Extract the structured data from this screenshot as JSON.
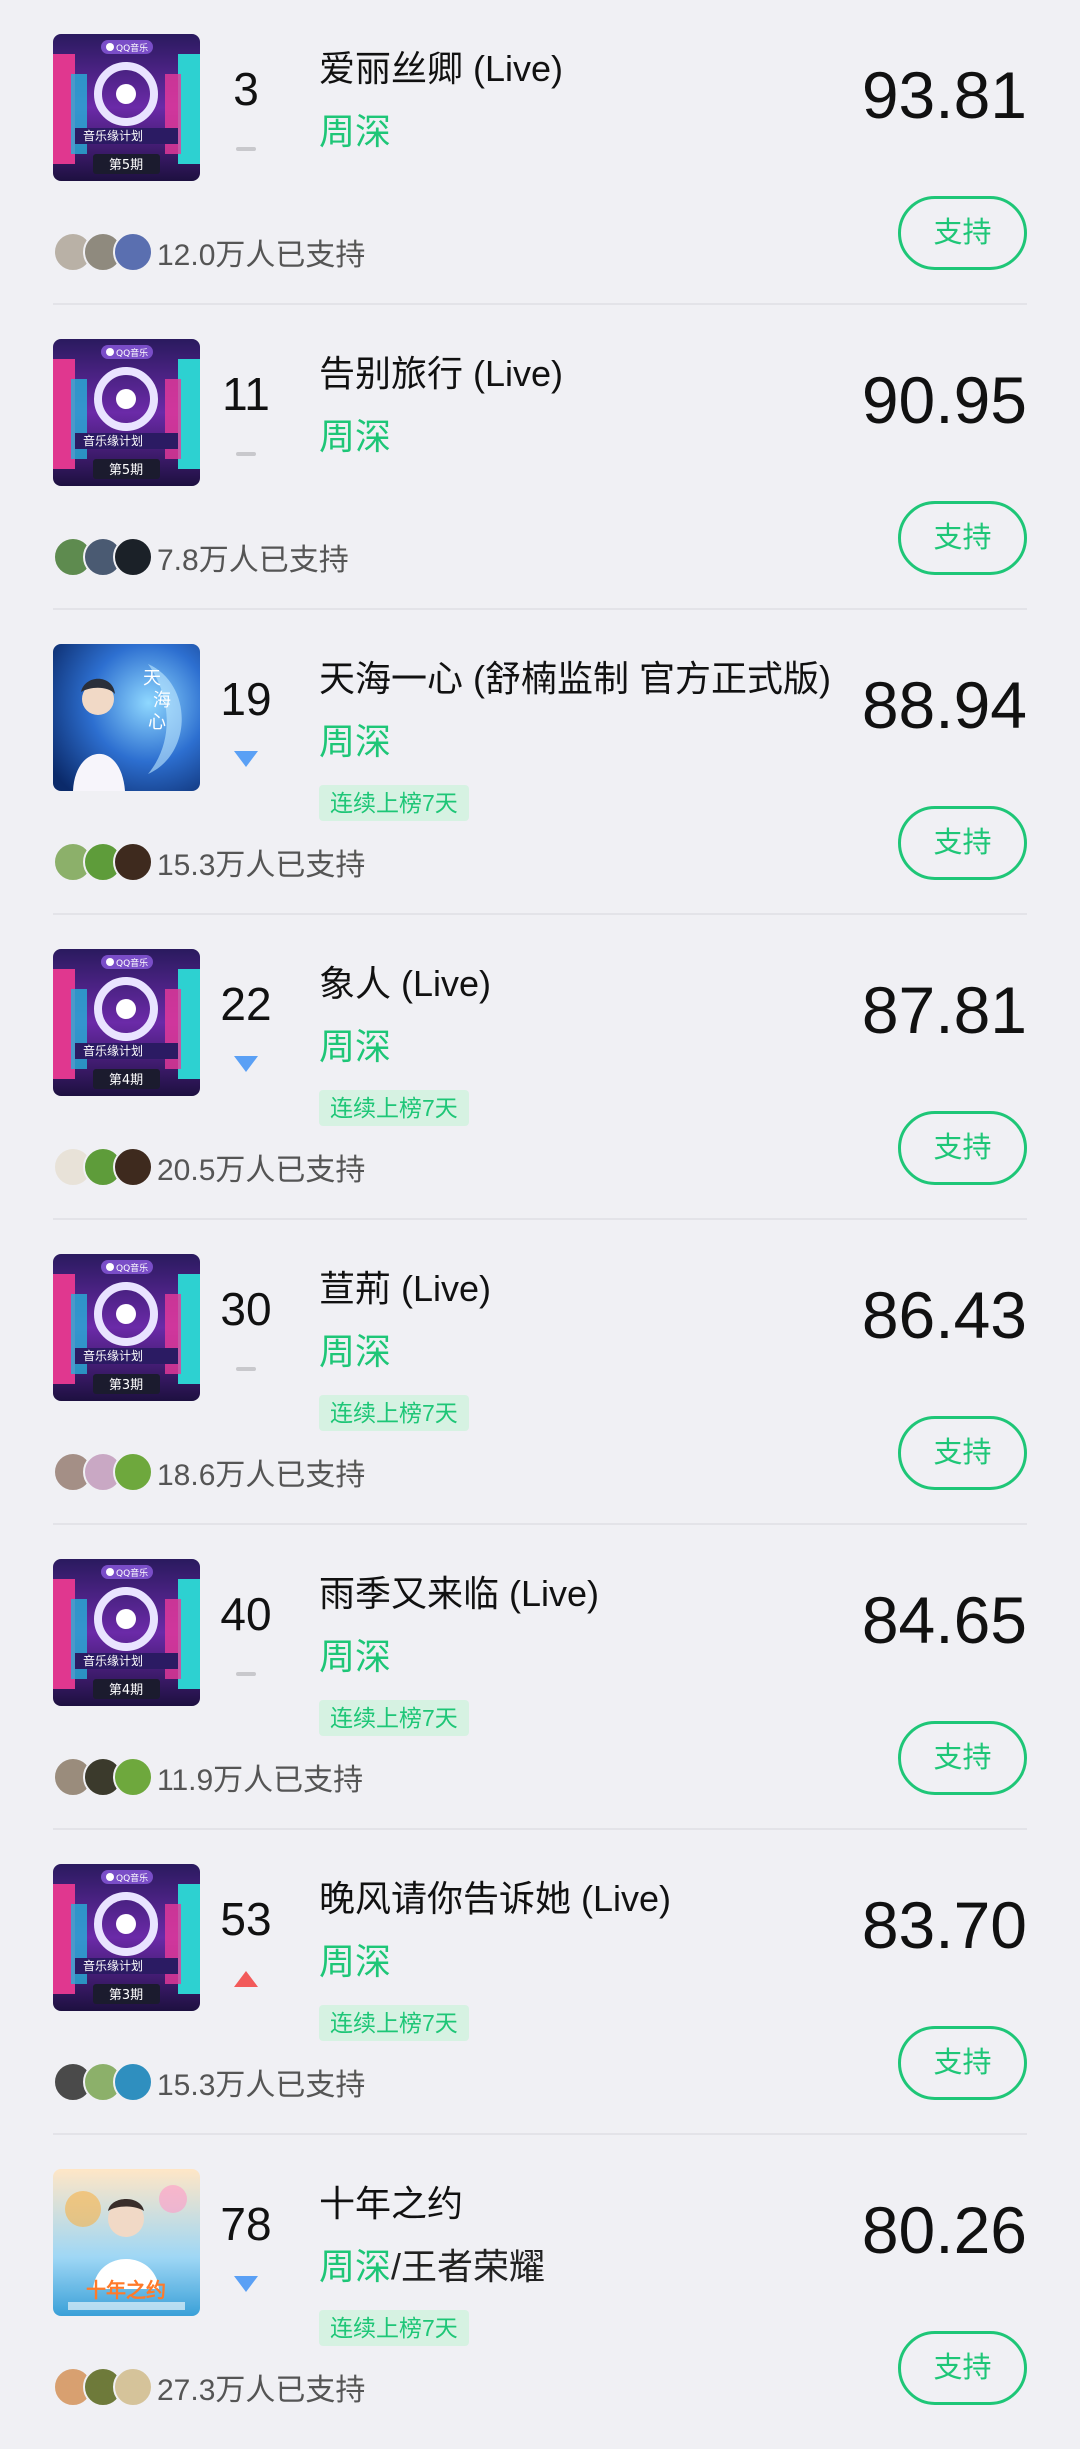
{
  "items": [
    {
      "rank": "3",
      "trend": "flat",
      "title": "爱丽丝卿 (Live)",
      "artists": [
        "周深"
      ],
      "badge": "",
      "score": "93.81",
      "supporters": "12.0万人已支持",
      "button": "支持",
      "cover": "show",
      "cover_episode": "第5期",
      "avatar_colors": [
        "#b9b1a6",
        "#8f8a7e",
        "#5a6fb0"
      ]
    },
    {
      "rank": "11",
      "trend": "flat",
      "title": "告别旅行 (Live)",
      "artists": [
        "周深"
      ],
      "badge": "",
      "score": "90.95",
      "supporters": "7.8万人已支持",
      "button": "支持",
      "cover": "show",
      "cover_episode": "第5期",
      "avatar_colors": [
        "#5e8b4f",
        "#4a5a72",
        "#1b2128"
      ]
    },
    {
      "rank": "19",
      "trend": "down",
      "title": "天海一心 (舒楠监制 官方正式版)",
      "artists": [
        "周深"
      ],
      "badge": "连续上榜7天",
      "score": "88.94",
      "supporters": "15.3万人已支持",
      "button": "支持",
      "cover": "ocean",
      "cover_episode": "",
      "avatar_colors": [
        "#8cb06a",
        "#5e9c3a",
        "#3e2a1e"
      ]
    },
    {
      "rank": "22",
      "trend": "down",
      "title": "象人 (Live)",
      "artists": [
        "周深"
      ],
      "badge": "连续上榜7天",
      "score": "87.81",
      "supporters": "20.5万人已支持",
      "button": "支持",
      "cover": "show",
      "cover_episode": "第4期",
      "avatar_colors": [
        "#e8e2d8",
        "#5e9c3a",
        "#3e2a1e"
      ]
    },
    {
      "rank": "30",
      "trend": "flat",
      "title": "荁荊 (Live)",
      "artists": [
        "周深"
      ],
      "badge": "连续上榜7天",
      "score": "86.43",
      "supporters": "18.6万人已支持",
      "button": "支持",
      "cover": "show",
      "cover_episode": "第3期",
      "avatar_colors": [
        "#a48f86",
        "#c9a8c4",
        "#6ea83d"
      ]
    },
    {
      "rank": "40",
      "trend": "flat",
      "title": "雨季又来临 (Live)",
      "artists": [
        "周深"
      ],
      "badge": "连续上榜7天",
      "score": "84.65",
      "supporters": "11.9万人已支持",
      "button": "支持",
      "cover": "show",
      "cover_episode": "第4期",
      "avatar_colors": [
        "#9a8c7c",
        "#3b3a2c",
        "#6ea83d"
      ]
    },
    {
      "rank": "53",
      "trend": "up",
      "title": "晚风请你告诉她 (Live)",
      "artists": [
        "周深"
      ],
      "badge": "连续上榜7天",
      "score": "83.70",
      "supporters": "15.3万人已支持",
      "button": "支持",
      "cover": "show",
      "cover_episode": "第3期",
      "avatar_colors": [
        "#4a4a4a",
        "#8cb06a",
        "#2f8fbf"
      ]
    },
    {
      "rank": "78",
      "trend": "down",
      "title": "十年之约",
      "artists": [
        "周深",
        "王者荣耀"
      ],
      "badge": "连续上榜7天",
      "score": "80.26",
      "supporters": "27.3万人已支持",
      "button": "支持",
      "cover": "decade",
      "cover_episode": "",
      "avatar_colors": [
        "#d8a070",
        "#6e7a3a",
        "#d5c39a"
      ]
    }
  ],
  "colors": {
    "accent": "#1ec677",
    "trend_up": "#f25a5a",
    "trend_down": "#5aa0f5",
    "trend_flat": "#c8c8cc",
    "badge_bg": "#d6f2e2",
    "background": "#f0f0f4"
  }
}
